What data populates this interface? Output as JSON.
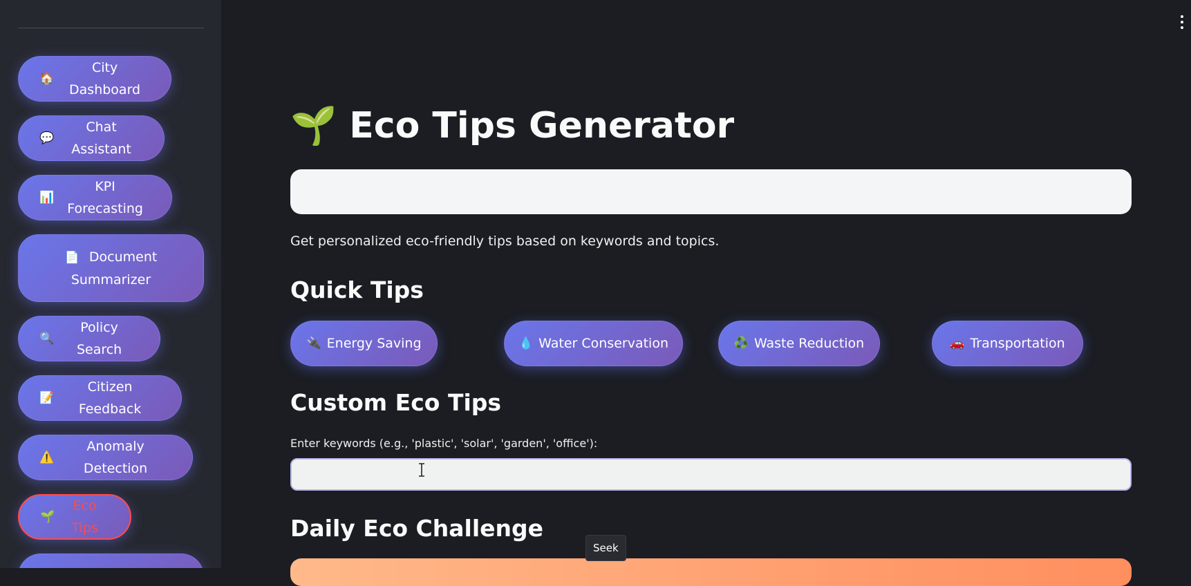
{
  "sidebar": {
    "items": [
      {
        "icon": "🏠",
        "label": "City Dashboard"
      },
      {
        "icon": "💬",
        "label": "Chat Assistant"
      },
      {
        "icon": "📊",
        "label": "KPI Forecasting"
      },
      {
        "icon": "📄",
        "label_line1": "Document",
        "label_line2": "Summarizer"
      },
      {
        "icon": "🔍",
        "label": "Policy Search"
      },
      {
        "icon": "📝",
        "label": "Citizen Feedback"
      },
      {
        "icon": "⚠️",
        "label": "Anomaly Detection"
      },
      {
        "icon": "🌱",
        "label": "Eco Tips"
      }
    ],
    "active_item": "Eco Tips"
  },
  "page": {
    "title_icon": "🌱",
    "title": "Eco Tips Generator",
    "subtitle": "Get personalized eco-friendly tips based on keywords and topics."
  },
  "quick_tips": {
    "heading": "Quick Tips",
    "buttons": [
      {
        "icon": "🔌",
        "label": "Energy Saving"
      },
      {
        "icon": "💧",
        "label": "Water Conservation"
      },
      {
        "icon": "♻️",
        "label": "Waste Reduction"
      },
      {
        "icon": "🚗",
        "label": "Transportation"
      }
    ]
  },
  "custom_tips": {
    "heading": "Custom Eco Tips",
    "input_label": "Enter keywords (e.g., 'plastic', 'solar', 'garden', 'office'):",
    "input_value": ""
  },
  "daily_challenge": {
    "heading": "Daily Eco Challenge"
  },
  "tooltip": {
    "text": "Seek"
  },
  "colors": {
    "background": "#1b1d23",
    "sidebar": "#262830",
    "button_gradient_start": "#6a76ea",
    "button_gradient_end": "#7a5ab8",
    "active_accent": "#ff4b4b",
    "challenge_gradient": "#ff9a6b"
  }
}
